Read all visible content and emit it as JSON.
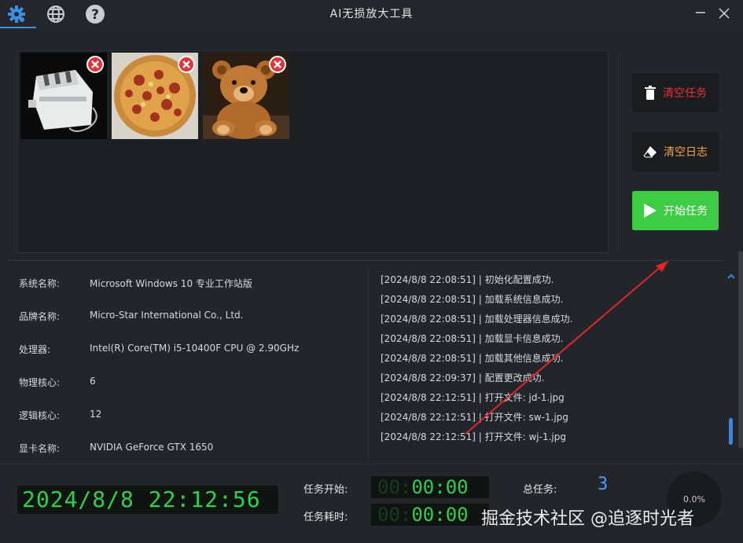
{
  "window": {
    "title": "AI无损放大工具"
  },
  "toolbar": {
    "settings_icon": "gear-icon",
    "language_icon": "globe-icon",
    "help_icon": "help-icon",
    "minimize_icon": "minimize-icon",
    "close_icon": "close-icon"
  },
  "images": [
    {
      "name": "toaster",
      "remove_icon": "remove-icon"
    },
    {
      "name": "pizza",
      "remove_icon": "remove-icon"
    },
    {
      "name": "teddy-bear",
      "remove_icon": "remove-icon"
    }
  ],
  "actions": {
    "clear_tasks": "清空任务",
    "clear_log": "清空日志",
    "start_task": "开始任务"
  },
  "system_info": [
    {
      "label": "系统名称:",
      "value": "Microsoft Windows 10 专业工作站版"
    },
    {
      "label": "品牌名称:",
      "value": "Micro-Star International Co., Ltd."
    },
    {
      "label": "处理器:",
      "value": "Intel(R) Core(TM) i5-10400F CPU @ 2.90GHz"
    },
    {
      "label": "物理核心:",
      "value": "6"
    },
    {
      "label": "逻辑核心:",
      "value": "12"
    },
    {
      "label": "显卡名称:",
      "value": "NVIDIA GeForce GTX 1650"
    }
  ],
  "log": [
    "[2024/8/8 22:08:51] | 初始化配置成功.",
    "[2024/8/8 22:08:51] | 加载系统信息成功.",
    "[2024/8/8 22:08:51] | 加载处理器信息成功.",
    "[2024/8/8 22:08:51] | 加载显卡信息成功.",
    "[2024/8/8 22:08:51] | 加载其他信息成功.",
    "[2024/8/8 22:09:37] | 配置更改成功.",
    "[2024/8/8 22:12:51] | 打开文件: jd-1.jpg",
    "[2024/8/8 22:12:51] | 打开文件: sw-1.jpg",
    "[2024/8/8 22:12:51] | 打开文件: wj-1.jpg"
  ],
  "status": {
    "clock": "2024/8/8 22:12:56",
    "task_start_label": "任务开始:",
    "task_start_value": "00:00",
    "task_elapsed_label": "任务耗时:",
    "task_elapsed_value": "00:00",
    "total_tasks_label": "总任务:",
    "total_tasks_value": "3",
    "progress": "0.0%"
  },
  "watermark": "掘金技术社区 @追逐时光者",
  "colors": {
    "accent": "#3d8fe0",
    "danger": "#e0353b",
    "warning": "#f2a640",
    "success": "#3ecc46",
    "lcd_green": "#2ed14e",
    "annotation_arrow": "#e0262b"
  }
}
